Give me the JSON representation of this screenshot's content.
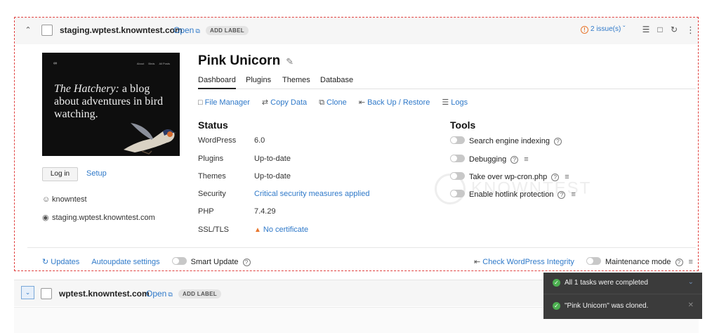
{
  "site1": {
    "domain": "staging.wptest.knowntest.com",
    "open_label": "Open",
    "add_label": "ADD LABEL",
    "issues_label": "2 issue(s)",
    "thumbnail": {
      "logo_text": "∞",
      "nav": [
        "About",
        "Birds",
        "All Posts"
      ],
      "headline_italic": "The Hatchery:",
      "headline_rest": " a blog about adventures in bird watching."
    },
    "login_label": "Log in",
    "setup_label": "Setup",
    "username": "knowntest",
    "site_url": "staging.wptest.knowntest.com",
    "title": "Pink Unicorn",
    "tabs": [
      "Dashboard",
      "Plugins",
      "Themes",
      "Database"
    ],
    "actions": [
      "File Manager",
      "Copy Data",
      "Clone",
      "Back Up / Restore",
      "Logs"
    ],
    "status_title": "Status",
    "status": [
      {
        "label": "WordPress",
        "value": "6.0"
      },
      {
        "label": "Plugins",
        "value": "Up-to-date"
      },
      {
        "label": "Themes",
        "value": "Up-to-date"
      },
      {
        "label": "Security",
        "value": "Critical security measures applied"
      },
      {
        "label": "PHP",
        "value": "7.4.29"
      },
      {
        "label": "SSL/TLS",
        "value": "No certificate"
      }
    ],
    "tools_title": "Tools",
    "tools": [
      "Search engine indexing",
      "Debugging",
      "Take over wp-cron.php",
      "Enable hotlink protection"
    ],
    "footer": {
      "updates": "Updates",
      "autoupdate": "Autoupdate settings",
      "smart_update": "Smart Update",
      "check_integrity": "Check WordPress Integrity",
      "maintenance": "Maintenance mode"
    }
  },
  "site2": {
    "domain": "wptest.knowntest.com",
    "open_label": "Open",
    "add_label": "ADD LABEL"
  },
  "watermark": "KNOWNTEST",
  "toasts": [
    "All 1 tasks were completed",
    "\"Pink Unicorn\" was cloned."
  ],
  "colors": {
    "link": "#2f79c9",
    "danger_border": "#e0403e",
    "warning": "#e8772e",
    "success": "#4caf50",
    "toast_bg": "#3b3b3b"
  }
}
